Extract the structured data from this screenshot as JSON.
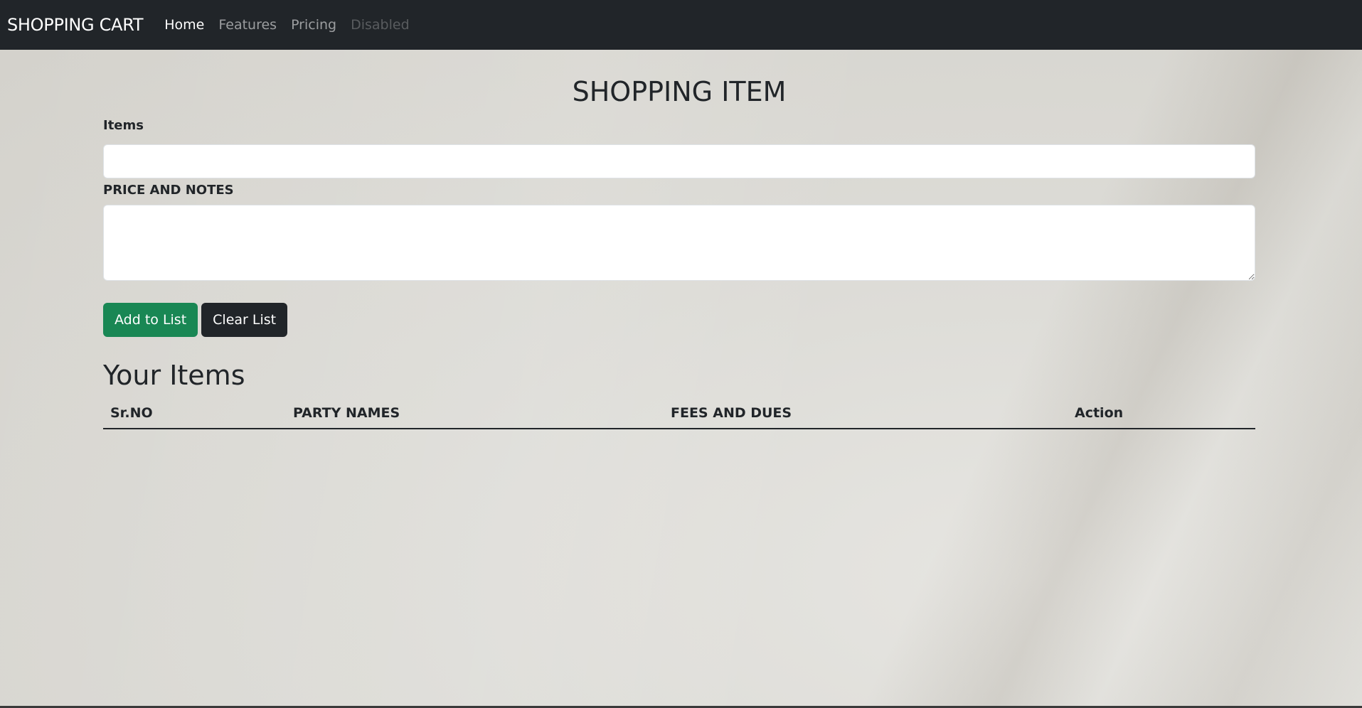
{
  "navbar": {
    "brand": "SHOPPING CART",
    "items": [
      {
        "label": "Home",
        "state": "active"
      },
      {
        "label": "Features",
        "state": "normal"
      },
      {
        "label": "Pricing",
        "state": "normal"
      },
      {
        "label": "Disabled",
        "state": "disabled"
      }
    ]
  },
  "main": {
    "title": "SHOPPING ITEM",
    "items_label": "Items",
    "items_value": "",
    "price_label": "PRICE AND NOTES",
    "price_value": "",
    "add_button": "Add to List",
    "clear_button": "Clear List",
    "list_title": "Your Items",
    "table_headers": [
      "Sr.NO",
      "PARTY NAMES",
      "FEES AND DUES",
      "Action"
    ],
    "rows": []
  },
  "colors": {
    "navbar_bg": "#212529",
    "add_button": "#198754",
    "clear_button": "#212529"
  }
}
